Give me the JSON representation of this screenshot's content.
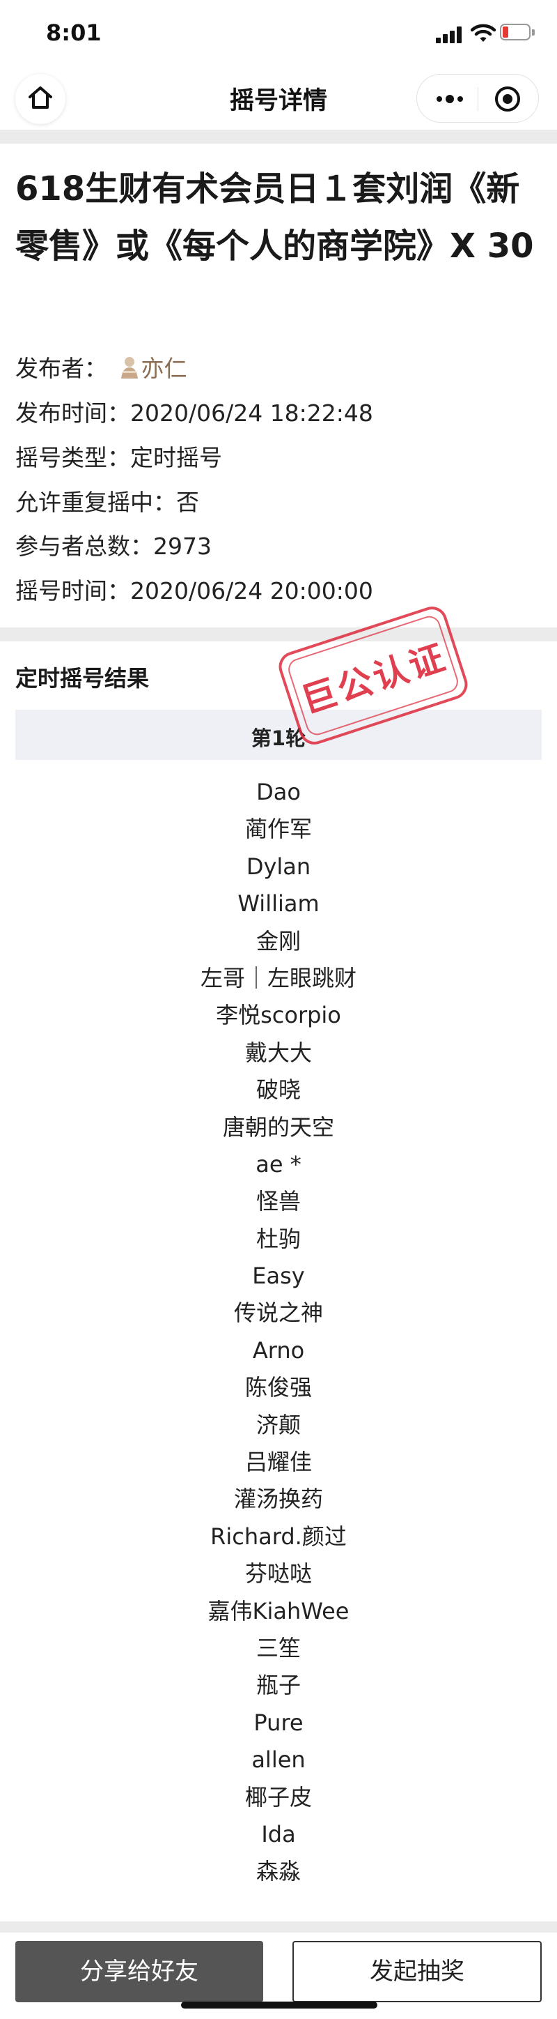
{
  "status_bar": {
    "time": "8:01"
  },
  "nav": {
    "title": "摇号详情"
  },
  "lottery": {
    "title": "618生财有术会员日１套刘润《新零售》或《每个人的商学院》X 30",
    "publisher_label": "发布者：",
    "publisher_name": "亦仁",
    "publish_time_label": "发布时间：",
    "publish_time": "2020/06/24 18:22:48",
    "type_label": "摇号类型：",
    "type": "定时摇号",
    "repeat_label": "允许重复摇中：",
    "repeat": "否",
    "participants_label": "参与者总数：",
    "participants": "2973",
    "draw_time_label": "摇号时间：",
    "draw_time": "2020/06/24 20:00:00"
  },
  "results": {
    "section_title": "定时摇号结果",
    "stamp_text": "巨公认证",
    "round_label": "第1轮",
    "winners": [
      "Dao",
      "蔺作军",
      "Dylan",
      "William",
      "金刚",
      "左哥｜左眼跳财",
      "李悦scorpio",
      "戴大大",
      "破晓",
      "唐朝的天空",
      "ae *",
      "怪兽",
      "杜驹",
      "Easy",
      "传说之神",
      "Arno",
      "陈俊强",
      "济颠",
      "吕耀佳",
      "灌汤换药",
      "Richard.颜过",
      "芬哒哒",
      "嘉伟KiahWee",
      "三笙",
      "瓶子",
      "Pure",
      "allen",
      "椰子皮",
      "Ida",
      "森淼"
    ]
  },
  "footer": {
    "share_label": "分享给好友",
    "draw_label": "发起抽奖"
  },
  "colors": {
    "stamp_red": "#dd2a3c",
    "share_button_bg": "#555555",
    "publisher_name": "#8a6d52"
  }
}
